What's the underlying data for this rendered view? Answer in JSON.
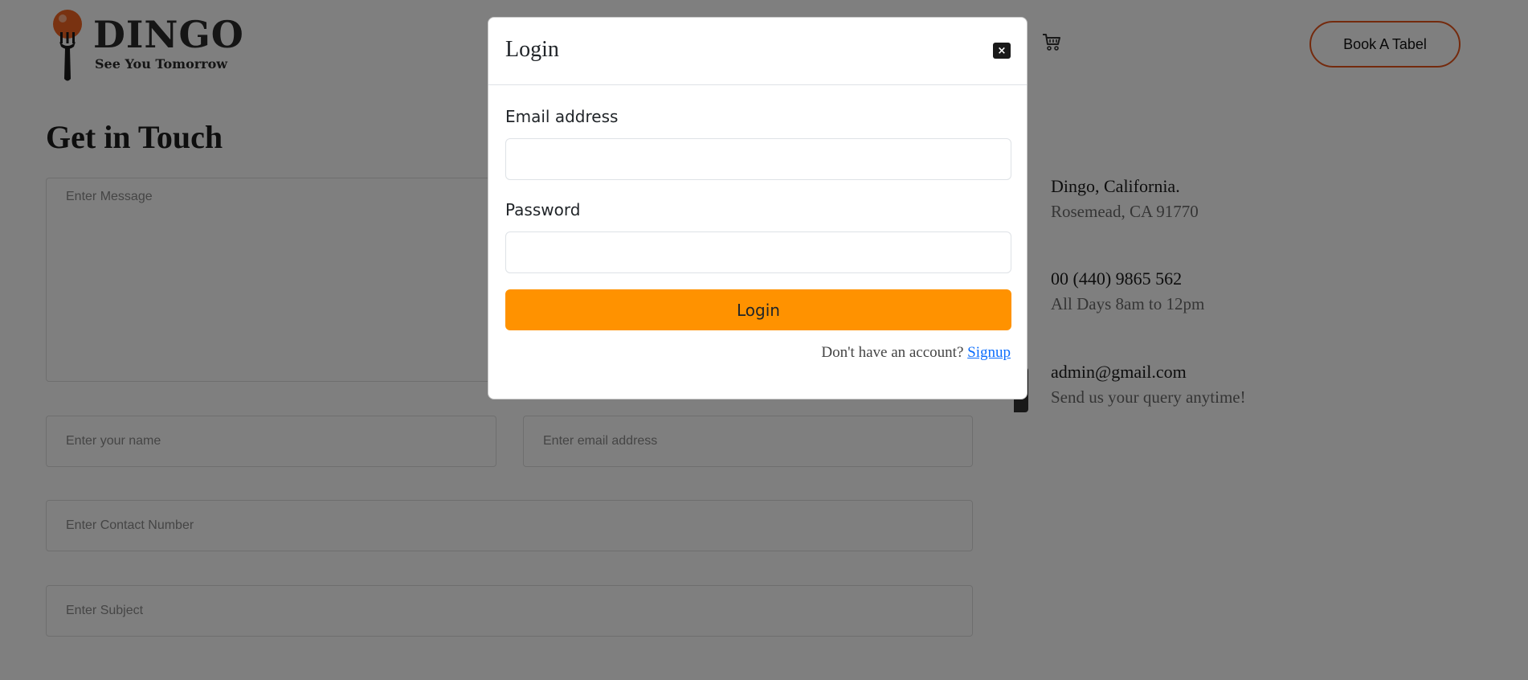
{
  "header": {
    "logo_title": "DINGO",
    "logo_subtitle": "See You Tomorrow",
    "cart_icon": "cart-icon",
    "book_button": "Book A Tabel"
  },
  "contact": {
    "heading": "Get in Touch",
    "message_placeholder": "Enter Message",
    "name_placeholder": "Enter your name",
    "email_placeholder": "Enter email address",
    "contact_placeholder": "Enter Contact Number",
    "subject_placeholder": "Enter Subject",
    "address_line1": "Dingo, California.",
    "address_line2": "Rosemead, CA 91770",
    "phone": "00 (440) 9865 562",
    "hours": "All Days 8am to 12pm",
    "email": "admin@gmail.com",
    "email_note": "Send us your query anytime!"
  },
  "modal": {
    "title": "Login",
    "close_symbol": "×",
    "email_label": "Email address",
    "email_value": "",
    "password_label": "Password",
    "password_value": "",
    "login_button": "Login",
    "signup_prompt": "Don't have an account?",
    "signup_link": "Signup"
  },
  "colors": {
    "accent_orange": "#ff9200",
    "book_border": "#e8541b",
    "link_blue": "#0d6efd",
    "logo_orange": "#f26522"
  }
}
